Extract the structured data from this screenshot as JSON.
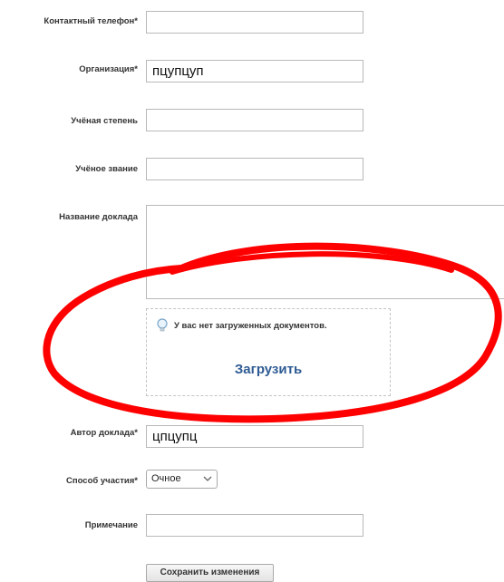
{
  "form": {
    "phone": {
      "label": "Контактный телефон*",
      "value": ""
    },
    "organization": {
      "label": "Организация*",
      "value": "пцупцуп"
    },
    "degree": {
      "label": "Учёная степень",
      "value": ""
    },
    "title": {
      "label": "Учёное звание",
      "value": ""
    },
    "report_name": {
      "label": "Название доклада",
      "value": ""
    },
    "documents": {
      "empty_notice": "У вас нет загруженных документов.",
      "upload_label": "Загрузить",
      "icon": "lightbulb-icon"
    },
    "author": {
      "label": "Автор доклада*",
      "value": "цпцупц"
    },
    "participation": {
      "label": "Способ участия*",
      "selected": "Очное"
    },
    "note": {
      "label": "Примечание",
      "value": ""
    },
    "save_label": "Сохранить изменения"
  },
  "colors": {
    "annotation": "#ff0000",
    "link": "#2e5b93"
  }
}
